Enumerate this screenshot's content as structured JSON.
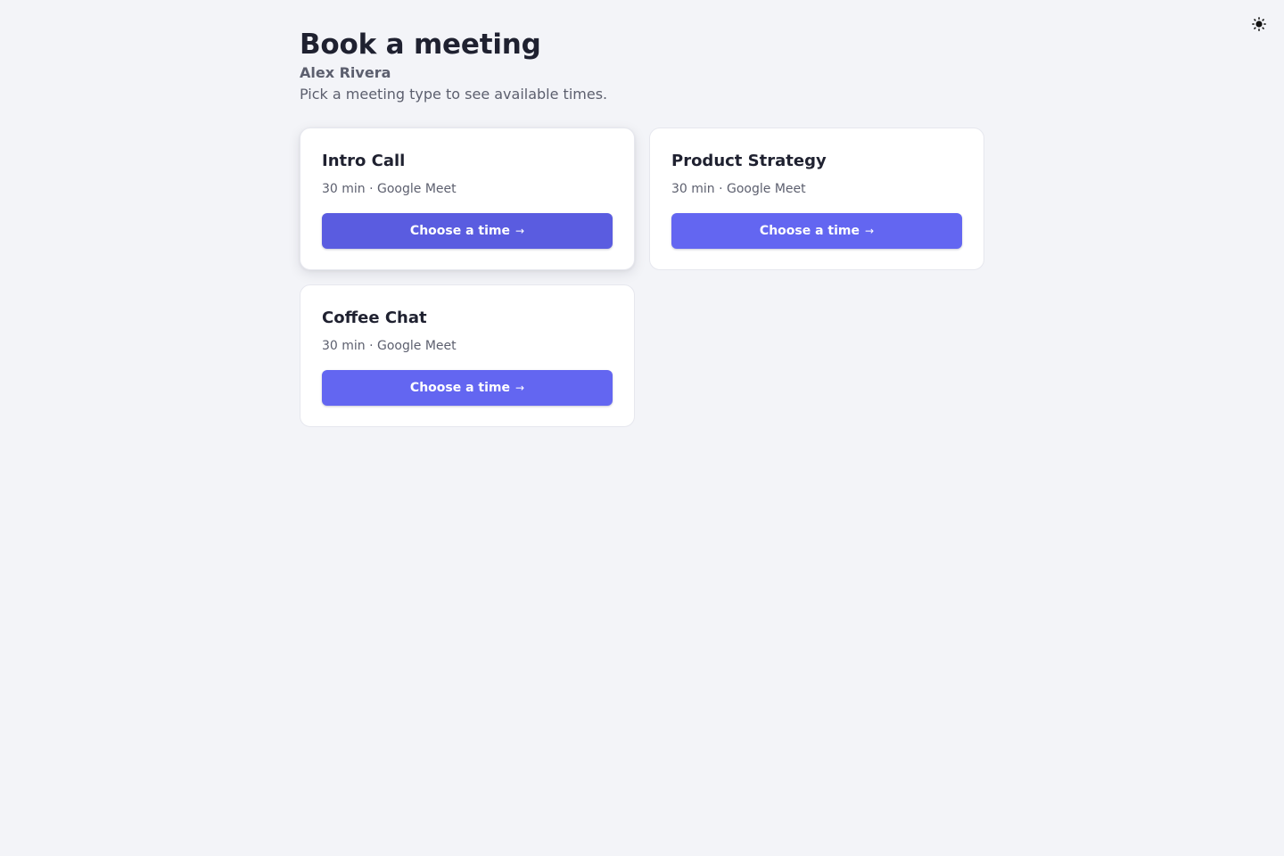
{
  "header": {
    "title": "Book a meeting",
    "host": "Alex Rivera",
    "subtitle": "Pick a meeting type to see available times."
  },
  "theme_toggle": {
    "icon": "sun-icon"
  },
  "meeting_types": [
    {
      "title": "Intro Call",
      "meta": "30 min · Google Meet",
      "button_label": "Choose a time",
      "button_arrow": "→"
    },
    {
      "title": "Product Strategy",
      "meta": "30 min · Google Meet",
      "button_label": "Choose a time",
      "button_arrow": "→"
    },
    {
      "title": "Coffee Chat",
      "meta": "30 min · Google Meet",
      "button_label": "Choose a time",
      "button_arrow": "→"
    }
  ],
  "colors": {
    "accent": "#6366f1",
    "accent_hover": "#5a5ce0",
    "background": "#f3f4f8",
    "card": "#ffffff",
    "text": "#1f2130",
    "muted": "#5c5f6e"
  }
}
